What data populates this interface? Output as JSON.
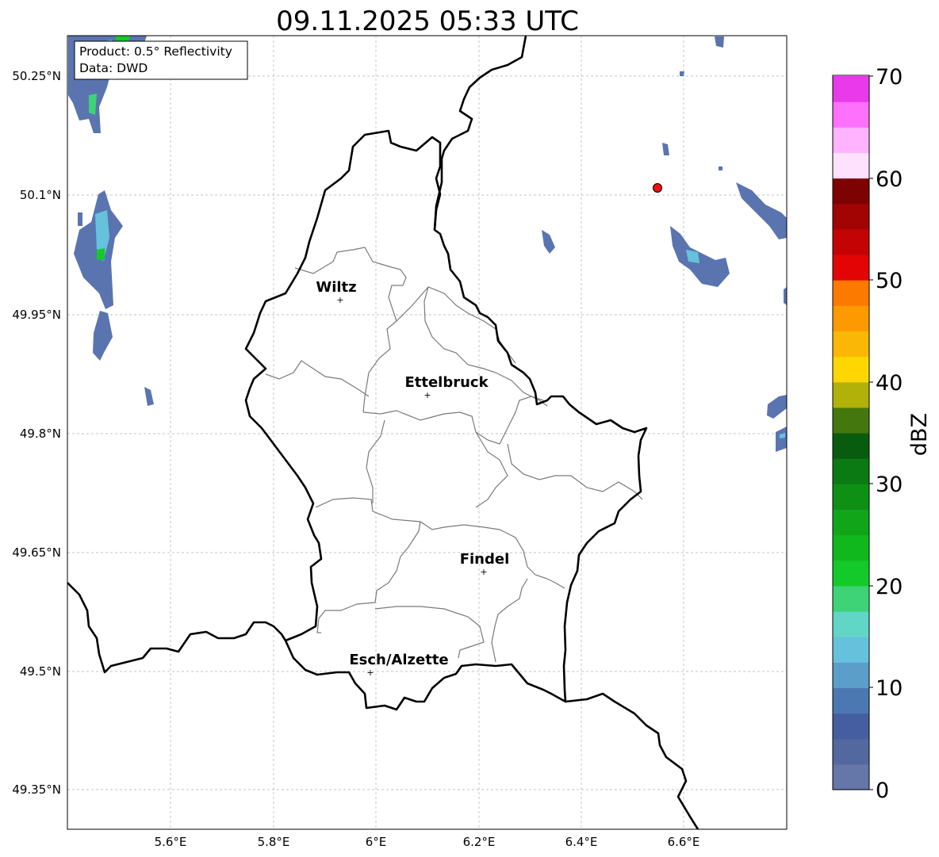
{
  "title": "09.11.2025 05:33 UTC",
  "info_box": {
    "product": "Product: 0.5° Reflectivity",
    "data_source": "Data: DWD"
  },
  "colorbar": {
    "label": "dBZ",
    "tick_labels": [
      "0",
      "10",
      "20",
      "30",
      "40",
      "50",
      "60",
      "70"
    ],
    "colors": [
      "#6577a8",
      "#53689f",
      "#445e9f",
      "#4c78b2",
      "#5a9ec9",
      "#66c1dc",
      "#61d6c7",
      "#3ed376",
      "#14c92a",
      "#11b81d",
      "#11a61a",
      "#0e9015",
      "#0b7a12",
      "#085c0e",
      "#44770d",
      "#b1b10a",
      "#fed702",
      "#fbb706",
      "#fd9a01",
      "#fd7a01",
      "#e30505",
      "#c40404",
      "#a20303",
      "#7d0202",
      "#fde1fd",
      "#feb3fe",
      "#fd71fd",
      "#e83ae8"
    ]
  },
  "map": {
    "lat_labels": [
      "50.25°N",
      "50.1°N",
      "49.95°N",
      "49.8°N",
      "49.65°N",
      "49.5°N",
      "49.35°N"
    ],
    "lon_labels": [
      "5.6°E",
      "5.8°E",
      "6°E",
      "6.2°E",
      "6.4°E",
      "6.6°E"
    ],
    "grid": true,
    "radar_site_color": "#ee1111",
    "cities": [
      {
        "name": "Wiltz"
      },
      {
        "name": "Ettelbruck"
      },
      {
        "name": "Findel"
      },
      {
        "name": "Esch/Alzette"
      }
    ]
  }
}
